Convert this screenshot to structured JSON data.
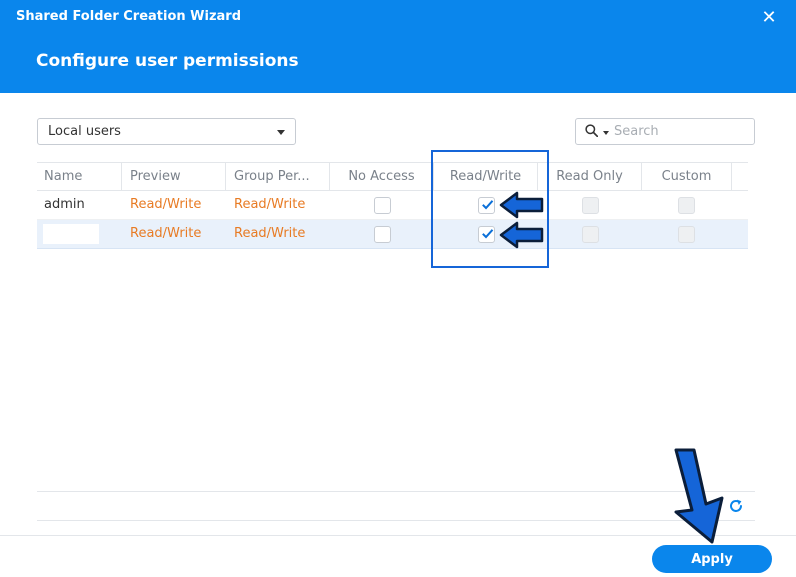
{
  "window": {
    "wizard_title": "Shared Folder Creation Wizard",
    "step_title": "Configure user permissions",
    "close_glyph": "✕"
  },
  "filter": {
    "user_type_selected": "Local users",
    "search_placeholder": "Search"
  },
  "table": {
    "columns": [
      "Name",
      "Preview",
      "Group Per...",
      "No Access",
      "Read/Write",
      "Read Only",
      "Custom"
    ],
    "rows": [
      {
        "name": "admin",
        "preview": "Read/Write",
        "group_permission": "Read/Write",
        "no_access": false,
        "read_write": true,
        "read_only": false,
        "custom": false
      },
      {
        "name": "",
        "preview": "Read/Write",
        "group_permission": "Read/Write",
        "no_access": false,
        "read_write": true,
        "read_only": false,
        "custom": false
      }
    ]
  },
  "footer": {
    "apply_label": "Apply"
  },
  "colors": {
    "header_bg": "#0a86ec",
    "permission_text": "#e87b24",
    "annotation_blue": "#1565d8",
    "selected_row": "#e9f1fb"
  },
  "icons": {
    "search": "search-icon",
    "refresh": "refresh-icon",
    "close": "close-icon",
    "dropdown": "chevron-down-icon",
    "annotation": "arrow-annotation-icon"
  }
}
